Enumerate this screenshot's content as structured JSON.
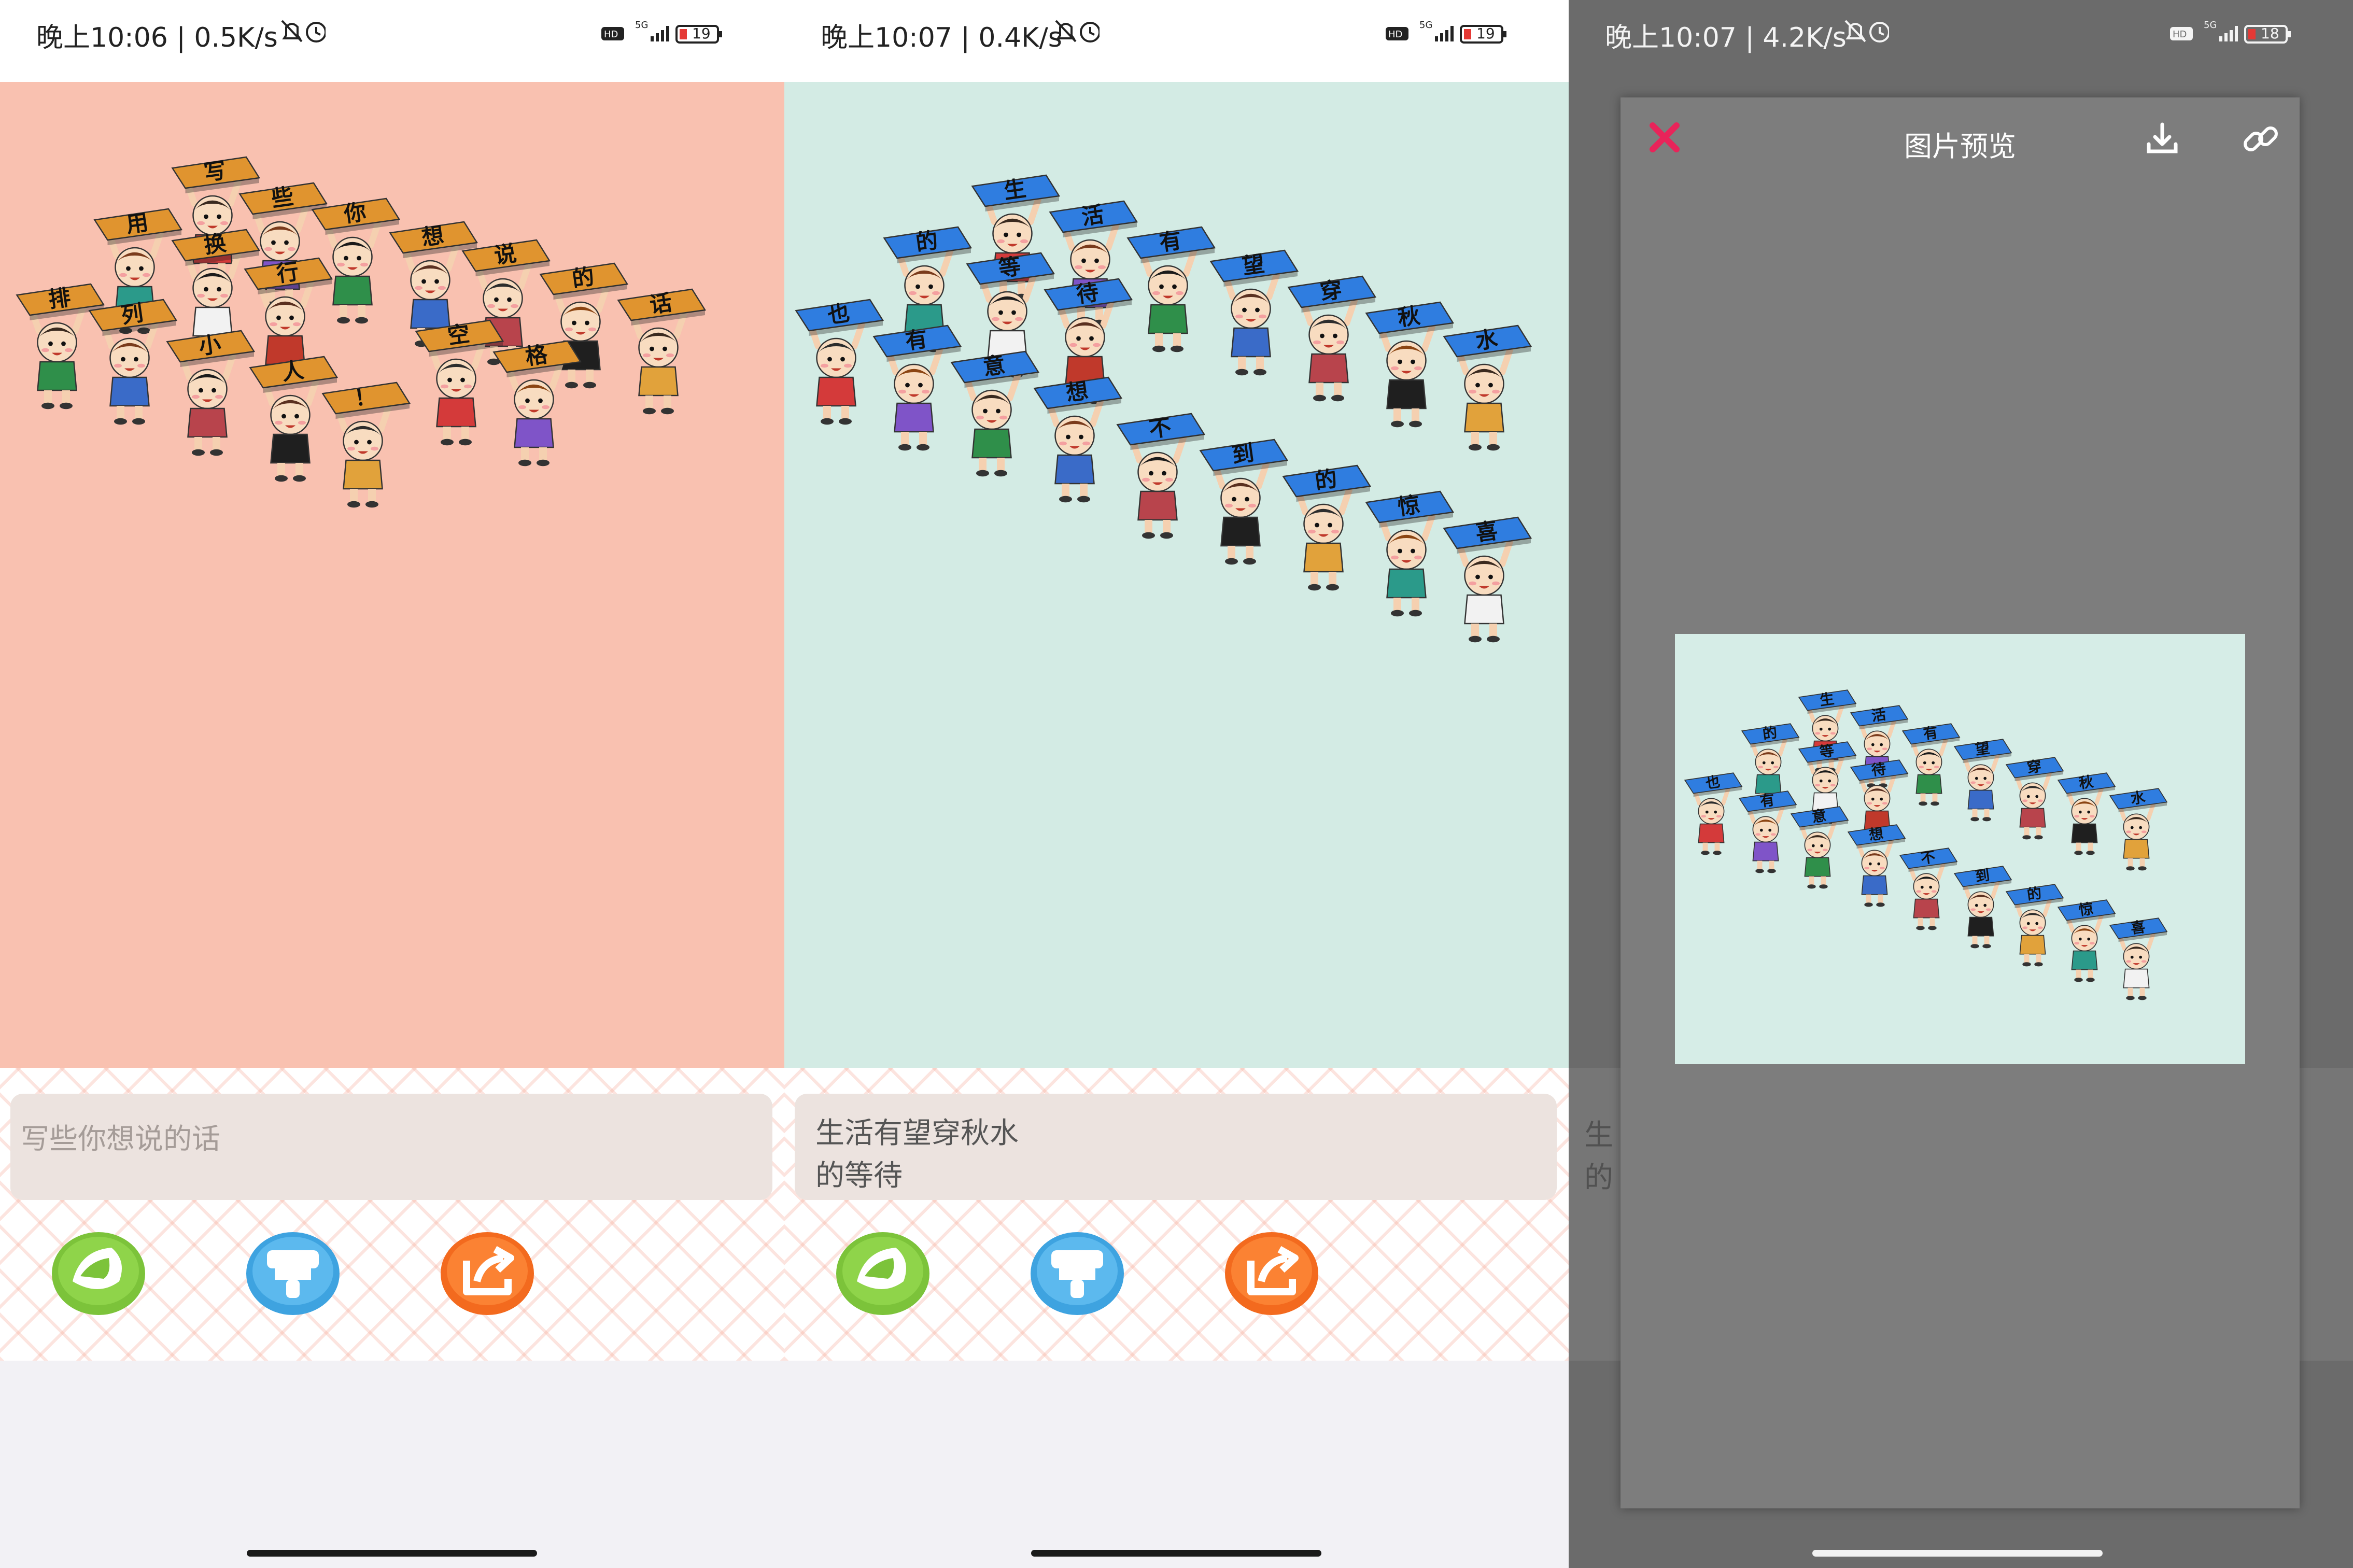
{
  "panels": [
    {
      "status": {
        "time": "晚上10:06 | 0.5K/s",
        "battery": "19"
      },
      "canvas_bg": "#f9c1b0",
      "sign_color": "#e0942f",
      "signs": [
        "写",
        "些",
        "你",
        "想",
        "说",
        "的",
        "话",
        "用",
        "换",
        "行",
        "空",
        "格",
        "排",
        "列",
        "小",
        "人",
        "！"
      ],
      "input_placeholder": "写些你想说的话",
      "input_value": ""
    },
    {
      "status": {
        "time": "晚上10:07 | 0.4K/s",
        "battery": "19"
      },
      "canvas_bg": "#d3ebe4",
      "sign_color": "#2f7de0",
      "signs": [
        "生",
        "活",
        "有",
        "望",
        "穿",
        "秋",
        "水",
        "的",
        "等",
        "待",
        "也",
        "有",
        "意",
        "想",
        "不",
        "到",
        "的",
        "惊",
        "喜"
      ],
      "input_placeholder": "",
      "input_value": "生活有望穿秋水\n的等待"
    },
    {
      "status": {
        "time": "晚上10:07 | 4.2K/s",
        "battery": "18"
      },
      "background_text": "生\n的",
      "modal": {
        "title": "图片预览",
        "close_icon": "close-icon",
        "download_icon": "download-icon",
        "link_icon": "link-icon"
      },
      "preview_bg": "#d6ede7"
    }
  ],
  "buttons": [
    {
      "name": "theme-button",
      "color": "#7cc33a",
      "icon": "palette-icon"
    },
    {
      "name": "clear-button",
      "color": "#3ea3e0",
      "icon": "brush-icon"
    },
    {
      "name": "share-button",
      "color": "#f36a1e",
      "icon": "share-icon"
    }
  ]
}
